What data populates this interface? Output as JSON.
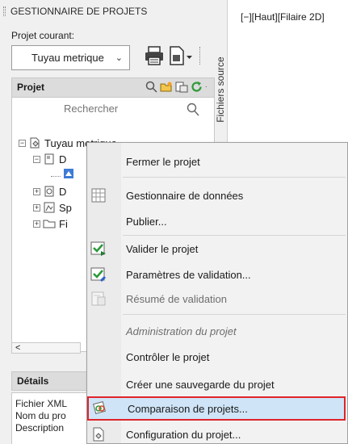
{
  "palette": {
    "title": "GESTIONNAIRE DE PROJETS",
    "current_project_label": "Projet courant:",
    "current_project_value": "Tuyau metrique",
    "side_tab": "Fichiers source"
  },
  "project_panel": {
    "header": "Projet",
    "search_placeholder": "Rechercher",
    "tree": [
      {
        "label": "Tuyau metrique",
        "expander": "−"
      },
      {
        "label": "D",
        "expander": "−"
      },
      {
        "label": "",
        "expander": ""
      },
      {
        "label": "D",
        "expander": "+"
      },
      {
        "label": "Sp",
        "expander": "+"
      },
      {
        "label": "Fi",
        "expander": "+"
      }
    ],
    "scroll_left": "<"
  },
  "details": {
    "header": "Détails",
    "lines": [
      "Fichier XML",
      "Nom du pro",
      "Description"
    ]
  },
  "viewport": {
    "label": "[−][Haut][Filaire 2D]"
  },
  "context_menu": {
    "items": [
      {
        "label": "Fermer le projet",
        "icon": "none"
      },
      {
        "label": "Gestionnaire de données",
        "icon": "data-manager-icon"
      },
      {
        "label": "Publier...",
        "icon": "none"
      },
      {
        "label": "Valider le projet",
        "icon": "validate-icon"
      },
      {
        "label": "Paramètres de validation...",
        "icon": "validation-settings-icon"
      },
      {
        "label": "Résumé de validation",
        "icon": "validation-summary-icon",
        "disabled": true
      },
      {
        "label": "Administration du projet",
        "section": true
      },
      {
        "label": "Contrôler le projet",
        "icon": "none"
      },
      {
        "label": "Créer une sauvegarde du projet",
        "icon": "none"
      },
      {
        "label": "Comparaison de projets...",
        "icon": "compare-projects-icon",
        "highlighted": true
      },
      {
        "label": "Configuration du projet...",
        "icon": "project-setup-icon"
      }
    ]
  },
  "colors": {
    "highlight_fill": "#cfe4f7",
    "highlight_border": "#e0242a",
    "panel_header": "#dcdcdc"
  }
}
